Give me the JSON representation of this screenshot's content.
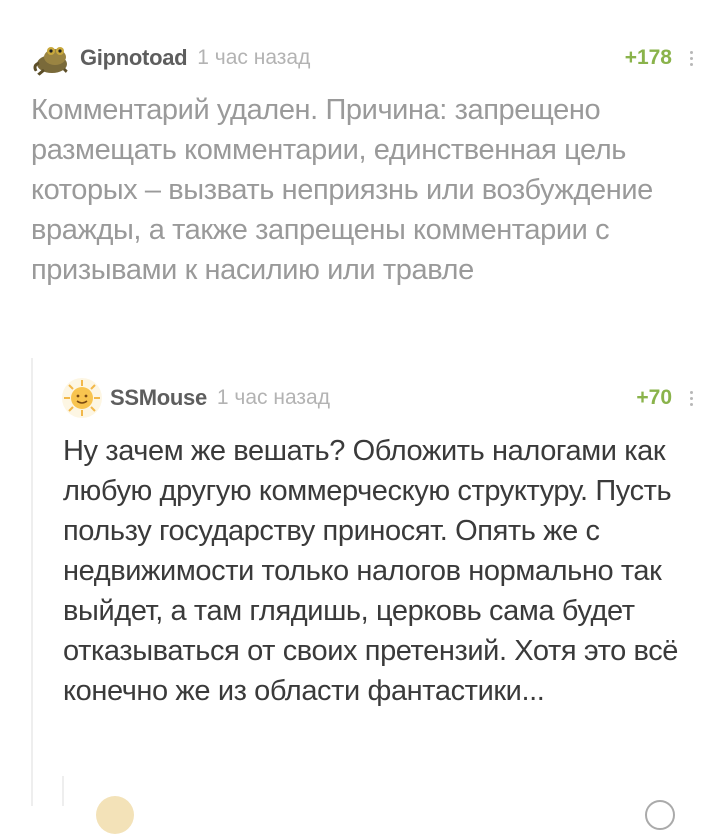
{
  "comments": [
    {
      "author": "Gipnotoad",
      "time": "1 час назад",
      "rating": "+178",
      "avatar_icon": "toad-icon",
      "text": "Комментарий удален. Причина: запрещено размещать комментарии, единственная цель которых – вызвать неприязнь или возбуждение вражды, а также запрещены комментарии с призывами к насилию или травле"
    },
    {
      "author": "SSMouse",
      "time": "1 час назад",
      "rating": "+70",
      "avatar_icon": "sun-face-icon",
      "text": "Ну зачем же вешать? Обложить налогами как любую другую коммерческую структуру. Пусть пользу государству приносят. Опять же с недвижимости только налогов нормально так выйдет, а там глядишь, церковь сама будет отказываться от своих претензий. Хотя это всё конечно же из области фантастики..."
    }
  ],
  "colors": {
    "rating": "#8ab34b",
    "nick": "#5e5e5e",
    "deleted_text": "#9a9a9a",
    "body_text": "#3a3a3a"
  }
}
